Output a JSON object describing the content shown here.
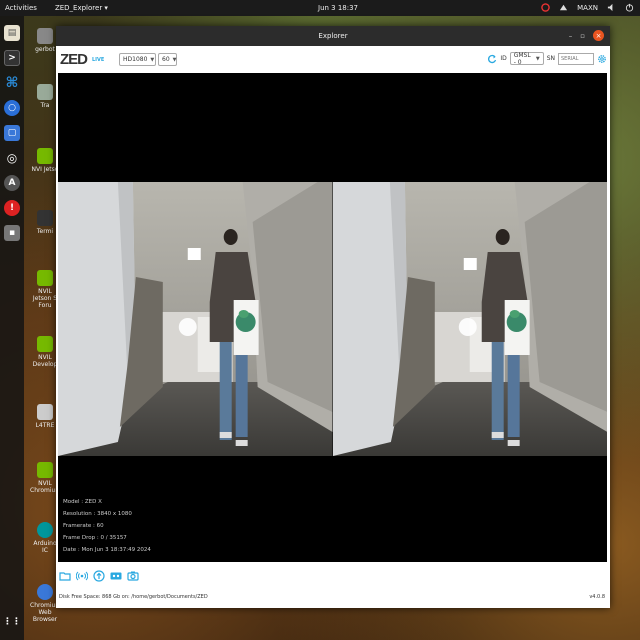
{
  "topbar": {
    "activities": "Activities",
    "app_menu": "ZED_Explorer ▾",
    "clock": "Jun 3  18:37",
    "power_mode": "MAXN"
  },
  "desktop_icons": [
    {
      "label": "gerbot"
    },
    {
      "label": "Tra"
    },
    {
      "label": "NVI Jetso"
    },
    {
      "label": "Termi"
    },
    {
      "label": "NVIL Jetson S Foru"
    },
    {
      "label": "NVIL Develop"
    },
    {
      "label": "L4TRE"
    },
    {
      "label": "NVIL Chromium"
    },
    {
      "label": "Arduino IC"
    },
    {
      "label": "Chromium Web Browser"
    }
  ],
  "window": {
    "title": "Explorer",
    "minimize": "–",
    "maximize": "▫",
    "close": "×"
  },
  "toolbar": {
    "logo": "ZED",
    "live_badge": "LIVE",
    "resolution": "HD1080",
    "fps": "60",
    "id_label": "ID",
    "camera_id": "GMSL - 0",
    "sn_label": "SN",
    "sn_placeholder": "SERIAL"
  },
  "info": {
    "model": "Model : ZED X",
    "resolution": "Resolution : 3840 x 1080",
    "framerate": "Framerate : 60",
    "frame_drop": "Frame Drop : 0 / 35157",
    "date": "Date : Mon Jun 3 18:37:49 2024"
  },
  "footer": {
    "disk": "Disk Free Space: 868 Gb  on: /home/gerbot/Documents/ZED",
    "version": "v4.0.8"
  },
  "colors": {
    "accent": "#29a8e0",
    "close": "#e95420",
    "video_bg": "#000000"
  }
}
